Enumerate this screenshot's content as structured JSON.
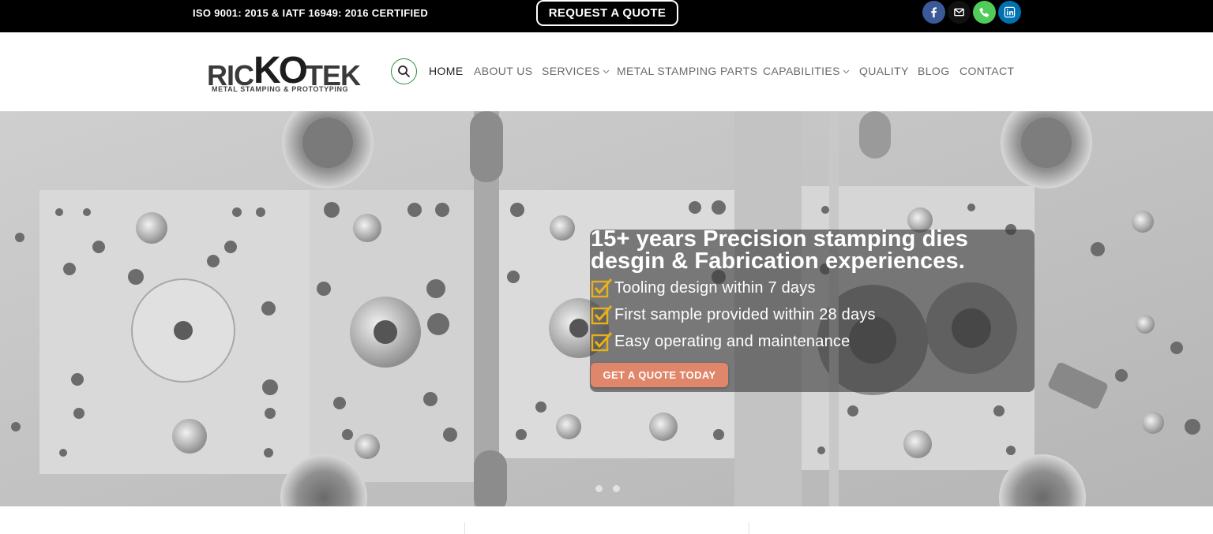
{
  "topbar": {
    "certification": "ISO 9001: 2015 & IATF 16949: 2016 CERTIFIED",
    "quote_button": "REQUEST A QUOTE",
    "social": [
      {
        "icon": "facebook-icon",
        "color": "#3b5998"
      },
      {
        "icon": "mail-icon",
        "color": "#111111"
      },
      {
        "icon": "phone-icon",
        "color": "#51cb5a"
      },
      {
        "icon": "linkedin-icon",
        "color": "#0072b1"
      }
    ]
  },
  "header": {
    "logo": {
      "text_a": "RIC",
      "text_b": "KO",
      "text_c": "TEK",
      "tagline": "METAL STAMPING & PROTOTYPING"
    },
    "search_icon": "search-icon",
    "nav": [
      {
        "label": "HOME",
        "active": true
      },
      {
        "label": "ABOUT US"
      },
      {
        "label": "SERVICES",
        "dropdown": true
      },
      {
        "label": "METAL STAMPING PARTS"
      },
      {
        "label": "CAPABILITIES",
        "dropdown": true
      },
      {
        "label": "QUALITY"
      },
      {
        "label": "BLOG"
      },
      {
        "label": "CONTACT"
      }
    ]
  },
  "hero": {
    "title_line1": "15+ years Precision stamping dies",
    "title_line2": "desgin & Fabrication experiences.",
    "features": [
      "Tooling design within 7 days",
      "First sample provided within 28 days",
      "Easy operating and maintenance"
    ],
    "cta": "GET A QUOTE TODAY",
    "accent_color": "#e0866a",
    "check_color": "#e8b019"
  }
}
